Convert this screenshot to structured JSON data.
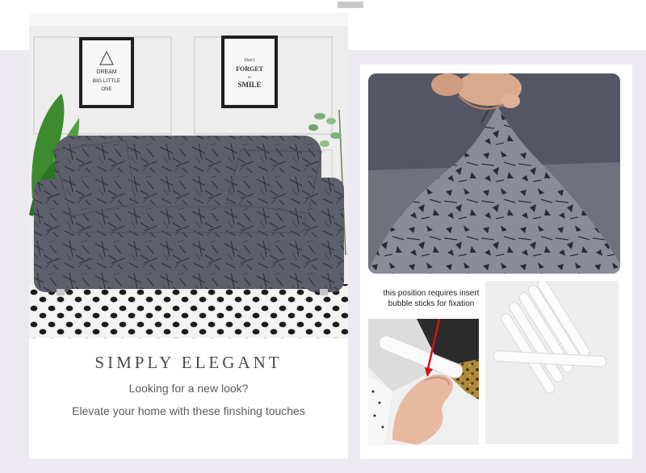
{
  "hero": {
    "headline": "SIMPLY ELEGANT",
    "subheading": "Looking for a new look?",
    "tagline": "Elevate your home with these finshing touches"
  },
  "wall_art": {
    "left_frame": [
      "DREAM",
      "BIG LITTLE",
      "ONE"
    ],
    "right_frame": [
      "Don't",
      "FORGET",
      "to",
      "SMILE"
    ]
  },
  "detail_note": {
    "line1": "this position requires insert",
    "line2": "bubble sticks for fixation"
  },
  "colors": {
    "band": "#eceaf0",
    "sofa": "#5c5e69",
    "fabric": "#7a7c88",
    "arrow": "#d0141c"
  },
  "icons": [
    "red-arrow-icon"
  ]
}
